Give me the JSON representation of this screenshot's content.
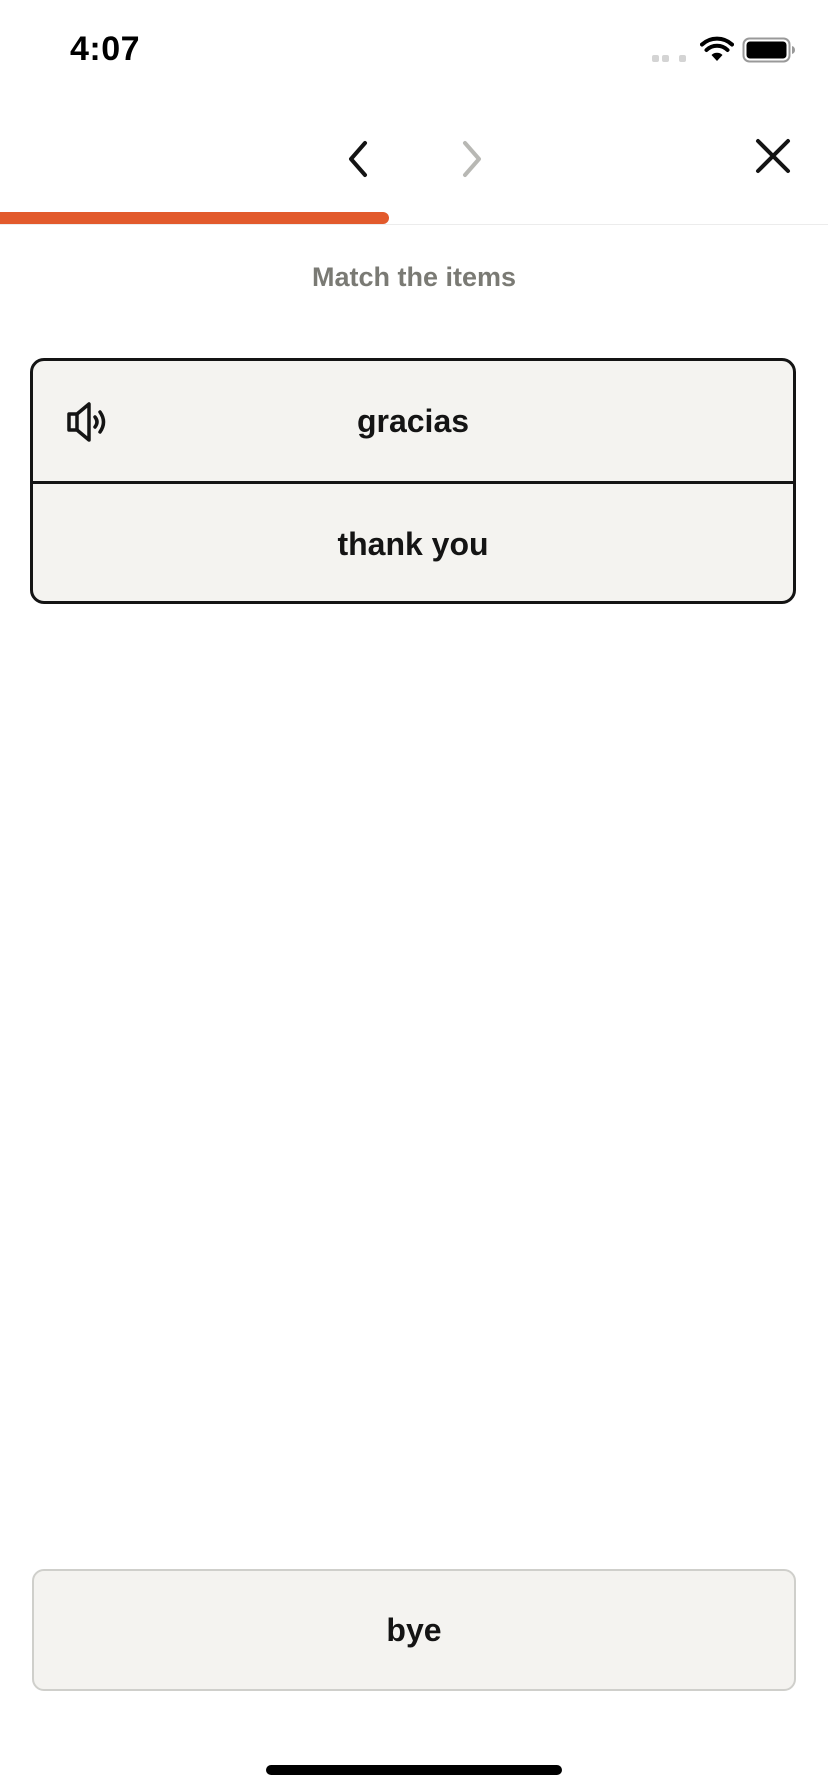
{
  "status_bar": {
    "time": "4:07",
    "icons": [
      "signal-icon",
      "wifi-icon",
      "battery-icon"
    ]
  },
  "header": {
    "prev_icon": "chevron-left-icon",
    "next_icon": "chevron-right-icon",
    "close_icon": "close-icon",
    "next_enabled": false
  },
  "progress": {
    "fraction": 0.47,
    "color": "#e25a2c"
  },
  "exercise": {
    "instruction": "Match the items",
    "pair": {
      "prompt": "gracias",
      "prompt_icon": "speaker-icon",
      "matched": "thank you"
    },
    "options": [
      {
        "label": "bye"
      }
    ]
  },
  "colors": {
    "accent": "#e25a2c",
    "card_background": "#f4f3f0",
    "instruction_text": "#7a7a74",
    "disabled_icon": "#b8b8b4"
  }
}
